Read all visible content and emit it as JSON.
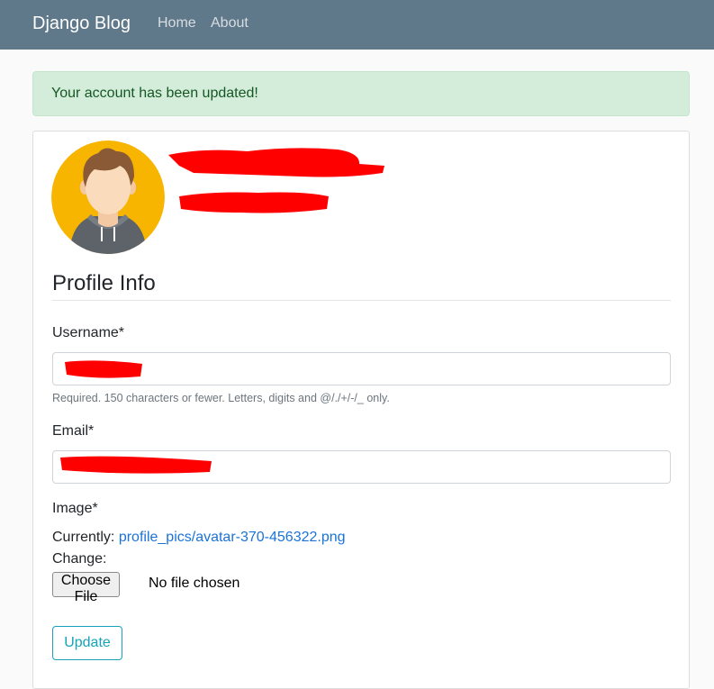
{
  "navbar": {
    "brand": "Django Blog",
    "links": [
      "Home",
      "About"
    ]
  },
  "alert": {
    "message": "Your account has been updated!"
  },
  "profile": {
    "section_title": "Profile Info"
  },
  "form": {
    "username_label": "Username*",
    "username_value": "",
    "username_help": "Required. 150 characters or fewer. Letters, digits and @/./+/-/_ only.",
    "email_label": "Email*",
    "email_value": "",
    "image_label": "Image*",
    "currently_label": "Currently:",
    "current_file": "profile_pics/avatar-370-456322.png",
    "change_label": "Change:",
    "choose_file_label": "Choose File",
    "no_file_text": "No file chosen",
    "submit_label": "Update"
  },
  "colors": {
    "navbar": "#5f788a",
    "alert_bg": "#d4edda",
    "alert_text": "#155724",
    "link": "#1a73d9",
    "accent": "#17a2b8"
  }
}
